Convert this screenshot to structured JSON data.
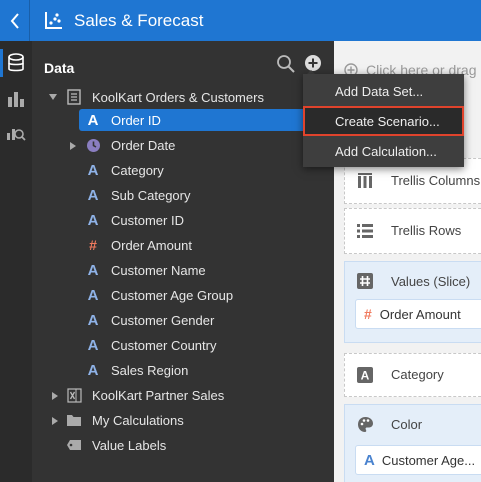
{
  "header": {
    "title": "Sales & Forecast"
  },
  "panel": {
    "title": "Data",
    "tree": [
      {
        "label": "KoolKart Orders & Customers",
        "icon": "document-icon"
      },
      {
        "label": "Order ID",
        "icon": "attribute-icon",
        "selected": true
      },
      {
        "label": "Order Date",
        "icon": "clock-icon"
      },
      {
        "label": "Category",
        "icon": "attribute-icon"
      },
      {
        "label": "Sub Category",
        "icon": "attribute-icon"
      },
      {
        "label": "Customer ID",
        "icon": "attribute-icon"
      },
      {
        "label": "Order Amount",
        "icon": "measure-icon"
      },
      {
        "label": "Customer Name",
        "icon": "attribute-icon"
      },
      {
        "label": "Customer Age Group",
        "icon": "attribute-icon"
      },
      {
        "label": "Customer Gender",
        "icon": "attribute-icon"
      },
      {
        "label": "Customer Country",
        "icon": "attribute-icon"
      },
      {
        "label": "Sales Region",
        "icon": "attribute-icon"
      },
      {
        "label": "KoolKart Partner Sales",
        "icon": "spreadsheet-icon"
      },
      {
        "label": "My Calculations",
        "icon": "folder-icon"
      },
      {
        "label": "Value Labels",
        "icon": "tag-icon"
      }
    ]
  },
  "menu": {
    "items": [
      {
        "label": "Add Data Set..."
      },
      {
        "label": "Create Scenario..."
      },
      {
        "label": "Add Calculation..."
      }
    ]
  },
  "canvas": {
    "drop_hint": "Click here or drag",
    "trellis_columns": "Trellis Columns",
    "trellis_rows": "Trellis Rows",
    "values_slice": "Values (Slice)",
    "values_pill": "Order Amount",
    "category": "Category",
    "color": "Color",
    "color_pill": "Customer Age..."
  },
  "colors": {
    "accent": "#1f76d2",
    "panel_bg": "#333333",
    "highlight_outline": "#e0432c"
  }
}
